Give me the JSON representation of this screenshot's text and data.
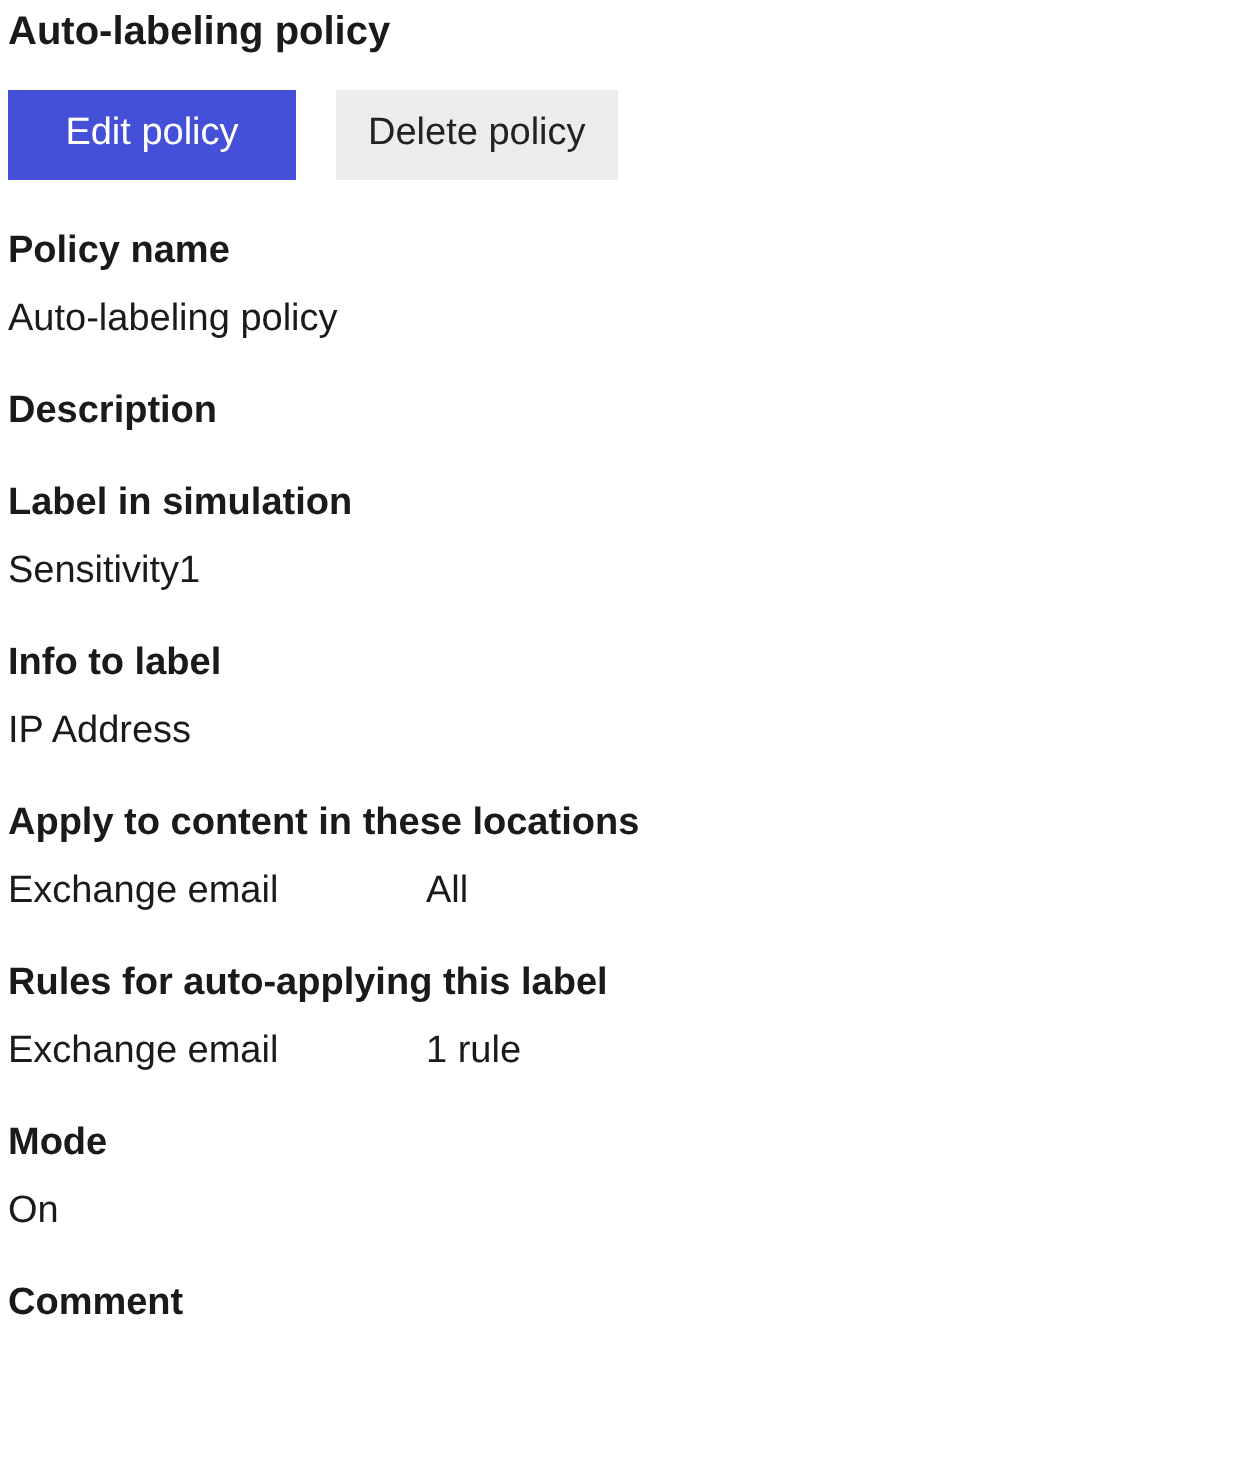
{
  "title": "Auto-labeling policy",
  "buttons": [
    {
      "label": "Edit policy",
      "kind": "primary"
    },
    {
      "label": "Delete policy",
      "kind": "secondary"
    }
  ],
  "fields": [
    {
      "kind": "text",
      "label": "Policy name",
      "value": "Auto-labeling policy"
    },
    {
      "kind": "empty",
      "label": "Description"
    },
    {
      "kind": "text",
      "label": "Label in simulation",
      "value": "Sensitivity1"
    },
    {
      "kind": "text",
      "label": "Info to label",
      "value": "IP Address"
    },
    {
      "kind": "pair",
      "label": "Apply to content in these locations",
      "name": "Exchange email",
      "value": "All"
    },
    {
      "kind": "pair",
      "label": "Rules for auto-applying this label",
      "name": "Exchange email",
      "value": "1 rule"
    },
    {
      "kind": "text",
      "label": "Mode",
      "value": "On"
    },
    {
      "kind": "empty",
      "label": "Comment"
    }
  ]
}
